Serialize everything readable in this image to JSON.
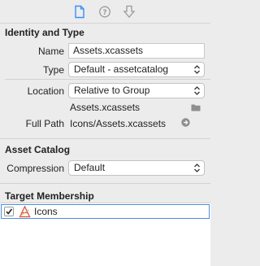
{
  "tabs": [
    {
      "icon": "file-inspector-icon",
      "active": true
    },
    {
      "icon": "quick-help-icon",
      "active": false
    },
    {
      "icon": "attributes-inspector-icon",
      "active": false
    }
  ],
  "identity": {
    "header": "Identity and Type",
    "name_label": "Name",
    "name_value": "Assets.xcassets",
    "type_label": "Type",
    "type_value": "Default - assetcatalog",
    "location_label": "Location",
    "location_value": "Relative to Group",
    "relative_path": "Assets.xcassets",
    "full_path_label": "Full Path",
    "full_path_value": "Icons/Assets.xcassets"
  },
  "asset_catalog": {
    "header": "Asset Catalog",
    "compression_label": "Compression",
    "compression_value": "Default"
  },
  "target_membership": {
    "header": "Target Membership",
    "targets": [
      {
        "name": "Icons",
        "checked": true,
        "icon": "app-target-icon"
      }
    ]
  },
  "colors": {
    "accent": "#4a90d9",
    "active_tab": "#3a8ef6",
    "inactive_tab": "#9a9a9a"
  }
}
